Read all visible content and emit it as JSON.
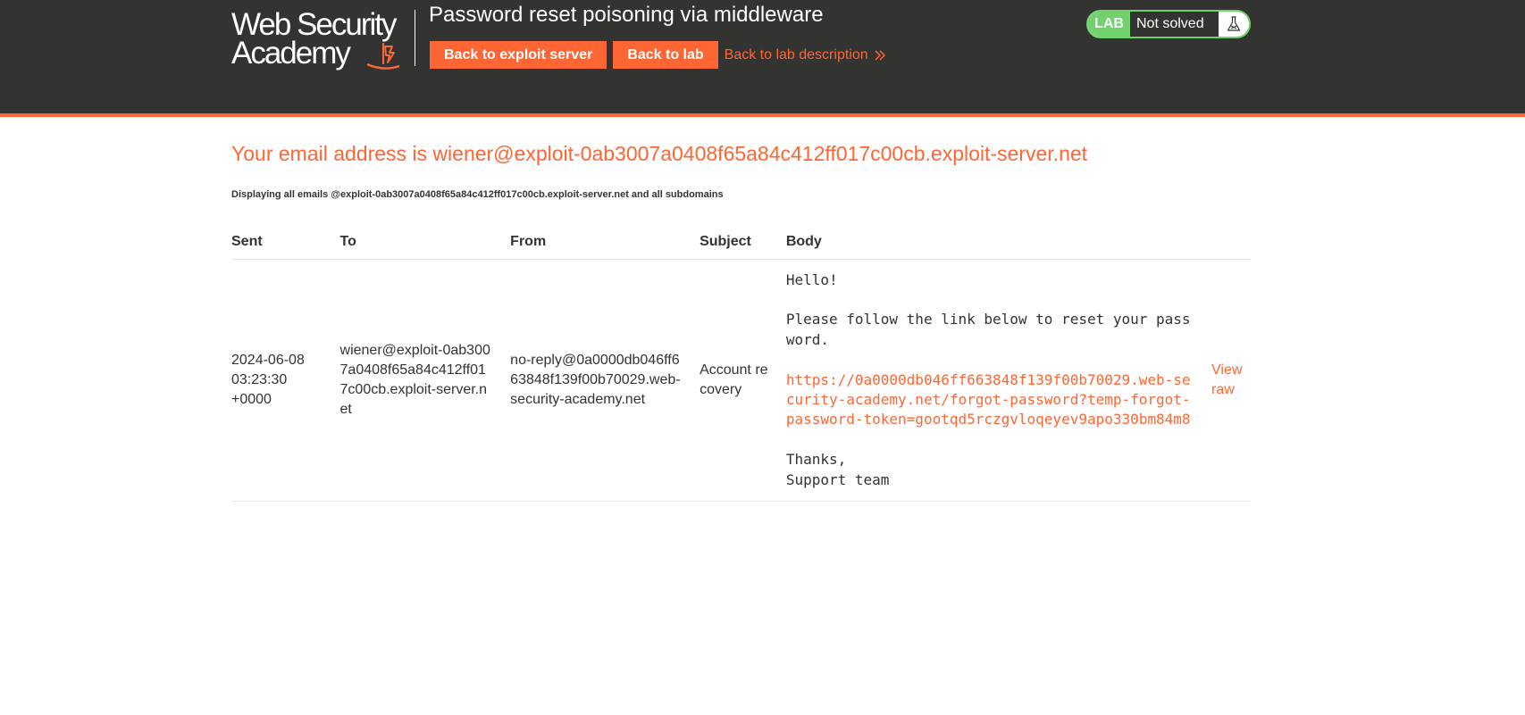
{
  "header": {
    "logo_line1": "Web Security",
    "logo_line2": "Academy",
    "lab_title": "Password reset poisoning via middleware",
    "back_to_exploit_server": "Back to exploit server",
    "back_to_lab": "Back to lab",
    "back_to_lab_description": "Back to lab description",
    "lab_badge": "LAB",
    "status": "Not solved",
    "status_icon": "flask-icon"
  },
  "colors": {
    "header_bg": "#333332",
    "accent": "#ff6633",
    "solved_green": "#70d16d"
  },
  "main": {
    "email_heading": "Your email address is wiener@exploit-0ab3007a0408f65a84c412ff017c00cb.exploit-server.net",
    "display_note": "Displaying all emails @exploit-0ab3007a0408f65a84c412ff017c00cb.exploit-server.net and all subdomains",
    "columns": [
      "Sent",
      "To",
      "From",
      "Subject",
      "Body"
    ],
    "emails": [
      {
        "sent": "2024-06-08 03:23:30 +0000",
        "to": "wiener@exploit-0ab3007a0408f65a84c412ff017c00cb.exploit-server.net",
        "from": "no-reply@0a0000db046ff663848f139f00b70029.web-security-academy.net",
        "subject": "Account recovery",
        "body_greeting": "Hello!",
        "body_instruction": "Please follow the link below to reset your password.",
        "body_link": "https://0a0000db046ff663848f139f00b70029.web-security-academy.net/forgot-password?temp-forgot-password-token=gootqd5rczgvloqeyev9apo330bm84m8",
        "body_signoff": "Thanks,\nSupport team",
        "view_raw": "View raw"
      }
    ]
  }
}
